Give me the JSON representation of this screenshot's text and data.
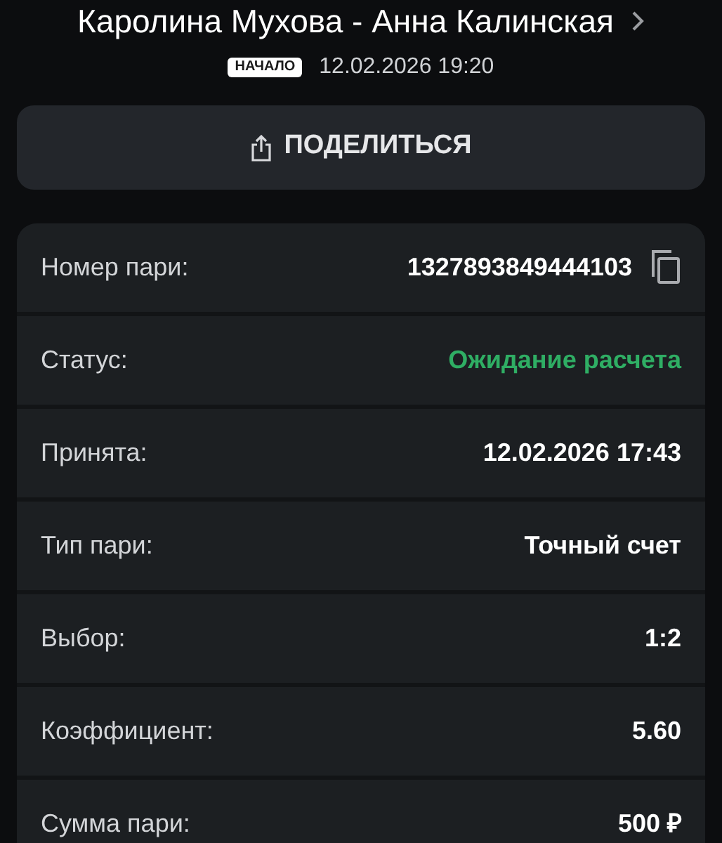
{
  "header": {
    "title": "Каролина Мухова - Анна Калинская",
    "badge": "НАЧАЛО",
    "datetime": "12.02.2026 19:20"
  },
  "share_button": {
    "label": "ПОДЕЛИТЬСЯ"
  },
  "details": [
    {
      "kind": "id",
      "label": "Номер пари:",
      "value": "1327893849444103"
    },
    {
      "kind": "status",
      "label": "Статус:",
      "value": "Ожидание расчета"
    },
    {
      "kind": "plain",
      "label": "Принята:",
      "value": "12.02.2026 17:43"
    },
    {
      "kind": "plain",
      "label": "Тип пари:",
      "value": "Точный счет"
    },
    {
      "kind": "plain",
      "label": "Выбор:",
      "value": "1:2"
    },
    {
      "kind": "plain",
      "label": "Коэффициент:",
      "value": "5.60"
    },
    {
      "kind": "plain",
      "label": "Сумма пари:",
      "value": "500 ₽"
    }
  ]
}
